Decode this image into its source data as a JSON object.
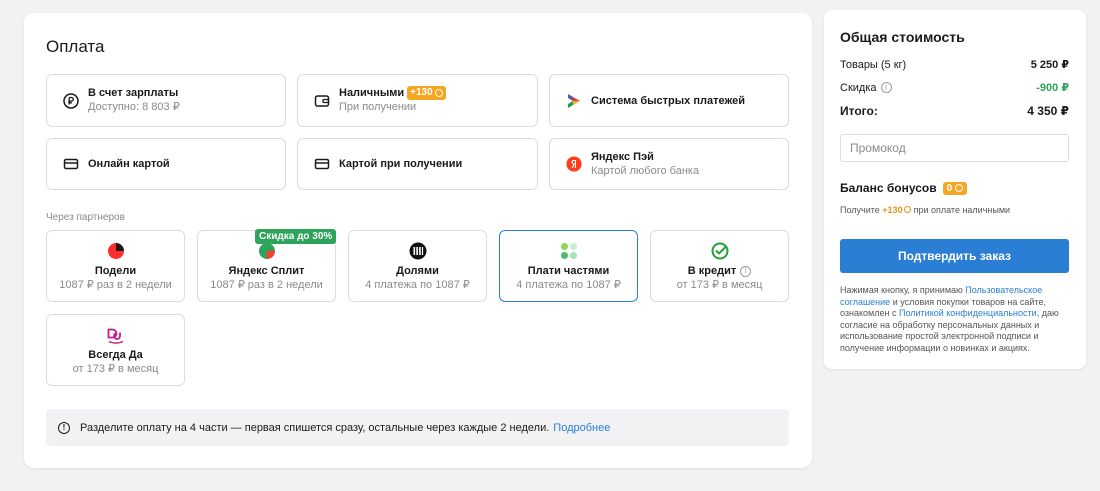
{
  "payment": {
    "title": "Оплата",
    "options": [
      {
        "label": "В счет зарплаты",
        "sub": "Доступно: 8 803 ₽"
      },
      {
        "label": "Наличными",
        "badge": "+130",
        "sub": "При получении"
      },
      {
        "label": "Система быстрых платежей"
      },
      {
        "label": "Онлайн картой"
      },
      {
        "label": "Картой при получении"
      },
      {
        "label": "Яндекс Пэй",
        "sub": "Картой любого банка"
      }
    ],
    "partners_label": "Через партнеров",
    "partners": [
      {
        "label": "Подели",
        "sub": "1087 ₽ раз в 2 недели"
      },
      {
        "label": "Яндекс Сплит",
        "sub": "1087 ₽ раз в 2 недели",
        "badge": "Скидка до 30%"
      },
      {
        "label": "Долями",
        "sub": "4 платежа по 1087 ₽"
      },
      {
        "label": "Плати частями",
        "sub": "4 платежа по 1087 ₽",
        "selected": true
      },
      {
        "label": "В кредит",
        "sub": "от 173 ₽ в месяц"
      },
      {
        "label": "Всегда Да",
        "sub": "от 173 ₽ в месяц"
      }
    ],
    "notice": {
      "text": "Разделите оплату на 4 части — первая спишется сразу, остальные через каждые 2 недели.",
      "link": "Подробнее"
    }
  },
  "summary": {
    "title": "Общая стоимость",
    "items_label": "Товары (5 кг)",
    "items_value": "5 250 ₽",
    "discount_label": "Скидка",
    "discount_value": "-900 ₽",
    "total_label": "Итого:",
    "total_value": "4 350 ₽",
    "promo_placeholder": "Промокод",
    "bonus_title": "Баланс бонусов",
    "bonus_value": "0",
    "bonus_note_pre": "Получите",
    "bonus_note_amount": "+130",
    "bonus_note_post": "при оплате наличными",
    "confirm_label": "Подтвердить заказ",
    "legal": {
      "t1": "Нажимая кнопку, я принимаю",
      "link1": "Пользовательское соглашение",
      "t2": "и условия покупки товаров на сайте, ознакомлен с",
      "link2": "Политикой конфиденциальности",
      "t3": ", даю согласие на обработку персональных данных и использование простой электронной подписи и получение информации о новинках и акциях."
    }
  },
  "colors": {
    "accent": "#2a7fd4",
    "green": "#2ea35a",
    "orange": "#f5a623"
  }
}
